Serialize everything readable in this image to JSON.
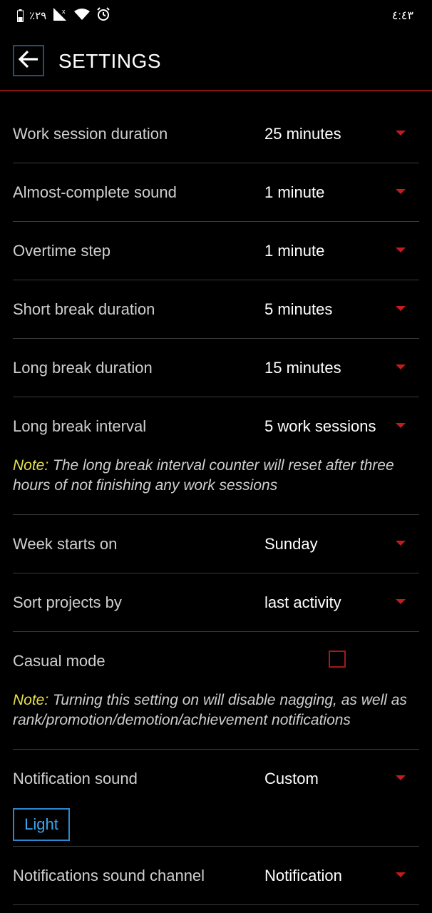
{
  "status_bar": {
    "battery_text": "٪٢٩",
    "time": "٤:٤٣",
    "icons": [
      "battery-icon",
      "signal-icon",
      "wifi-icon",
      "alarm-icon"
    ]
  },
  "app_bar": {
    "title": "SETTINGS",
    "back_icon": "back-arrow-icon"
  },
  "settings": {
    "work_session_duration": {
      "label": "Work session duration",
      "value": "25 minutes"
    },
    "almost_complete_sound": {
      "label": "Almost-complete sound",
      "value": "1 minute"
    },
    "overtime_step": {
      "label": "Overtime step",
      "value": "1 minute"
    },
    "short_break_duration": {
      "label": "Short break duration",
      "value": "5 minutes"
    },
    "long_break_duration": {
      "label": "Long break duration",
      "value": "15 minutes"
    },
    "long_break_interval": {
      "label": "Long break interval",
      "value": "5 work sessions",
      "note_key": "Note:",
      "note_text": "The long break interval counter will reset after three hours of not finishing any work sessions"
    },
    "week_starts_on": {
      "label": "Week starts on",
      "value": "Sunday"
    },
    "sort_projects_by": {
      "label": "Sort projects by",
      "value": "last activity"
    },
    "casual_mode": {
      "label": "Casual mode",
      "checked": false,
      "note_key": "Note:",
      "note_text": "Turning this setting on will disable nagging, as well as rank/promotion/demotion/achievement notifications"
    },
    "notification_sound": {
      "label": "Notification sound",
      "value": "Custom",
      "button_label": "Light"
    },
    "notifications_sound_channel": {
      "label": "Notifications sound channel",
      "value": "Notification"
    }
  },
  "colors": {
    "background": "#000000",
    "accent_red": "#c41c1c",
    "divider": "#3a3a3a",
    "note_yellow": "#e7e04b",
    "button_blue": "#3aa6ee"
  }
}
